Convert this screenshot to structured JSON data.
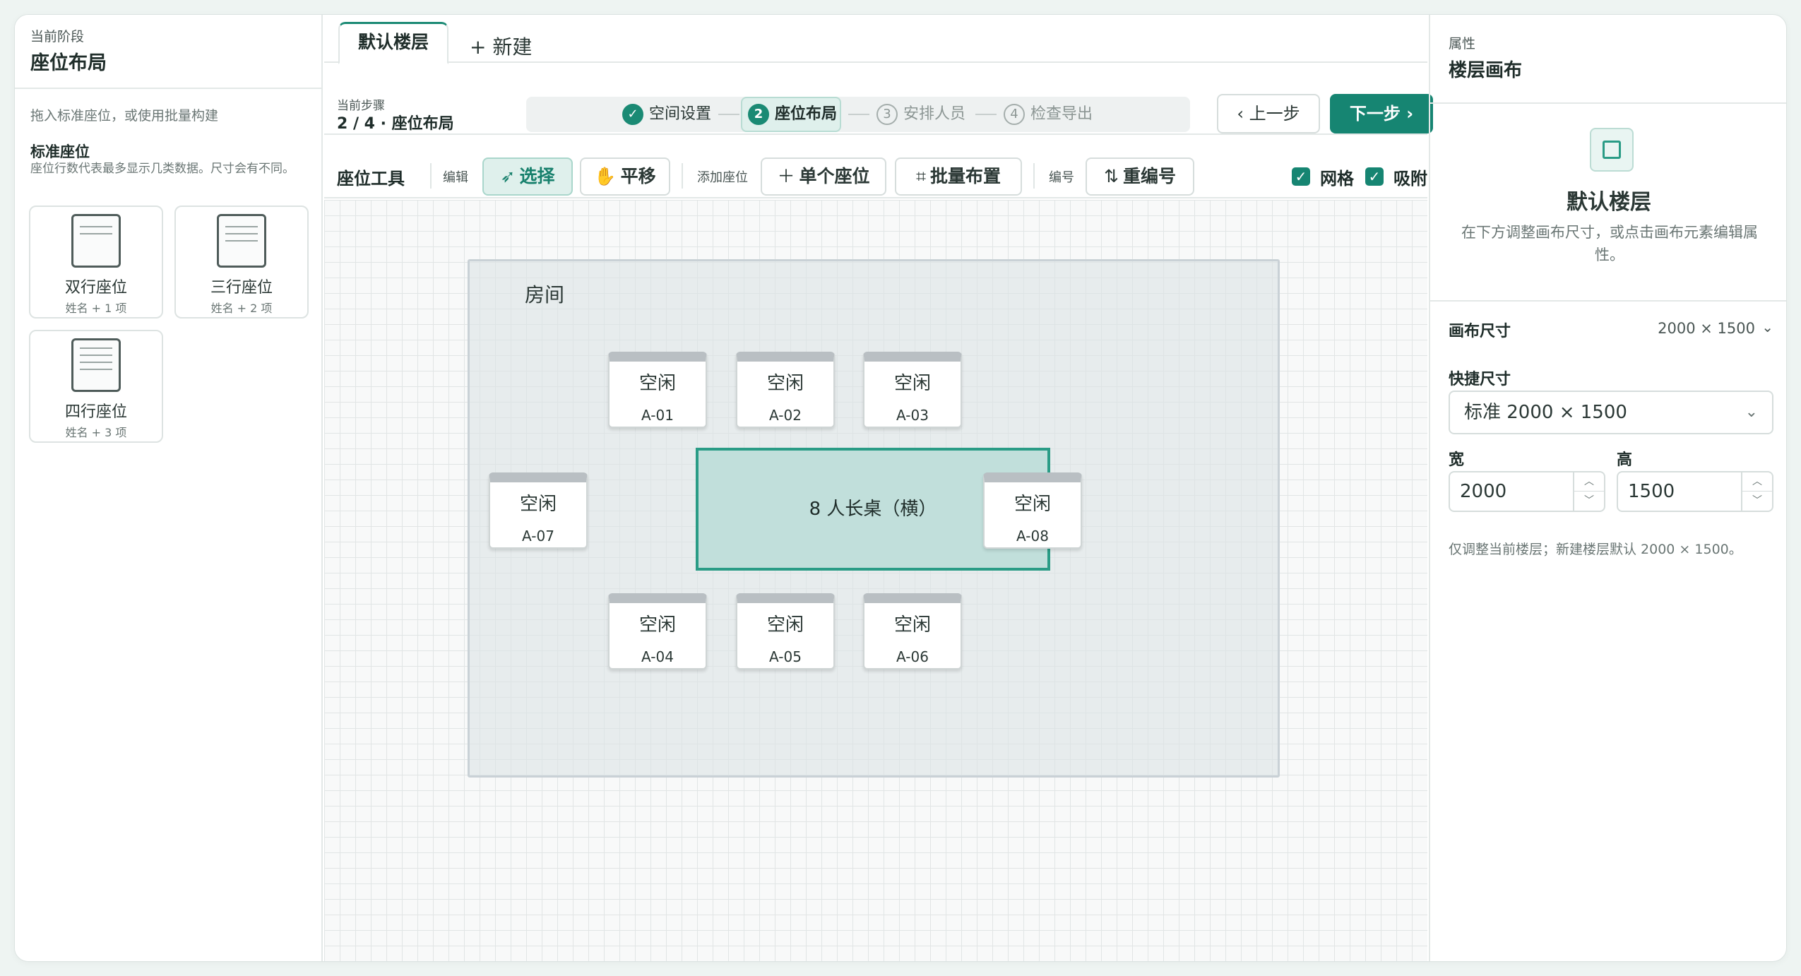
{
  "left": {
    "stage_label": "当前阶段",
    "stage_title": "座位布局",
    "hint": "拖入标准座位，或使用批量构建",
    "standard_title": "标准座位",
    "standard_desc": "座位行数代表最多显示几类数据。尺寸会有不同。",
    "templates": [
      {
        "name": "双行座位",
        "sub": "姓名 + 1 项"
      },
      {
        "name": "三行座位",
        "sub": "姓名 + 2 项"
      },
      {
        "name": "四行座位",
        "sub": "姓名 + 3 项"
      }
    ]
  },
  "tabs": {
    "active": "默认楼层",
    "new": "+ 新建"
  },
  "stepbar": {
    "current_label": "当前步骤",
    "current_value": "2 / 4 · 座位布局",
    "steps": [
      {
        "num": "✓",
        "label": "空间设置",
        "state": "done"
      },
      {
        "num": "2",
        "label": "座位布局",
        "state": "active"
      },
      {
        "num": "3",
        "label": "安排人员",
        "state": "pending"
      },
      {
        "num": "4",
        "label": "检查导出",
        "state": "pending"
      }
    ],
    "prev_label": "‹ 上一步",
    "next_label": "下一步 ›"
  },
  "toolbar": {
    "title": "座位工具",
    "edit_label": "编辑",
    "select_label": "选择",
    "pan_label": "平移",
    "add_label": "添加座位",
    "single_label": "单个座位",
    "batch_label": "批量布置",
    "number_label": "编号",
    "renumber_label": "重编号",
    "grid_label": "网格",
    "snap_label": "吸附",
    "grid_checked": true,
    "snap_checked": true
  },
  "canvas": {
    "room_label": "房间",
    "table_label": "8 人长桌（横）",
    "seats": [
      {
        "status": "空闲",
        "id": "A-01"
      },
      {
        "status": "空闲",
        "id": "A-02"
      },
      {
        "status": "空闲",
        "id": "A-03"
      },
      {
        "status": "空闲",
        "id": "A-04"
      },
      {
        "status": "空闲",
        "id": "A-05"
      },
      {
        "status": "空闲",
        "id": "A-06"
      },
      {
        "status": "空闲",
        "id": "A-07"
      },
      {
        "status": "空闲",
        "id": "A-08"
      }
    ]
  },
  "right": {
    "label": "属性",
    "title": "楼层画布",
    "floor_name": "默认楼层",
    "desc": "在下方调整画布尺寸，或点击画布元素编辑属性。",
    "size_label": "画布尺寸",
    "size_value": "2000 × 1500",
    "quick_label": "快捷尺寸",
    "quick_value": "标准 2000 × 1500",
    "width_label": "宽",
    "height_label": "高",
    "width_value": "2000",
    "height_value": "1500",
    "note": "仅调整当前楼层；新建楼层默认 2000 × 1500。"
  },
  "colors": {
    "accent": "#168572",
    "table_fill": "#c1dfdb",
    "seat_header": "#b9bfc3"
  }
}
